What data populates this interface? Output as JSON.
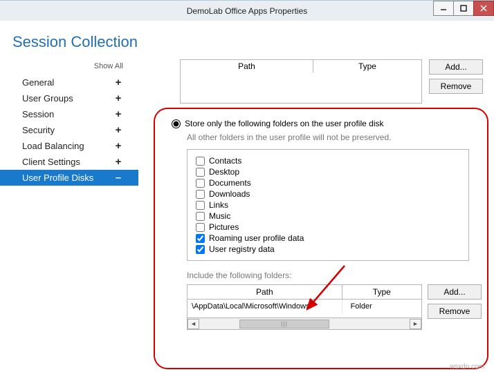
{
  "window": {
    "title": "DemoLab Office Apps Properties"
  },
  "page_title": "Session Collection",
  "show_all": "Show All",
  "nav": [
    {
      "label": "General",
      "exp": "+"
    },
    {
      "label": "User Groups",
      "exp": "+"
    },
    {
      "label": "Session",
      "exp": "+"
    },
    {
      "label": "Security",
      "exp": "+"
    },
    {
      "label": "Load Balancing",
      "exp": "+"
    },
    {
      "label": "Client Settings",
      "exp": "+"
    },
    {
      "label": "User Profile Disks",
      "exp": "–"
    }
  ],
  "top_table": {
    "col_path": "Path",
    "col_type": "Type",
    "add": "Add...",
    "remove": "Remove"
  },
  "radio_label": "Store only the following folders on the user profile disk",
  "note": "All other folders in the user profile will not be preserved.",
  "folders": [
    {
      "label": "Contacts",
      "checked": false
    },
    {
      "label": "Desktop",
      "checked": false
    },
    {
      "label": "Documents",
      "checked": false
    },
    {
      "label": "Downloads",
      "checked": false
    },
    {
      "label": "Links",
      "checked": false
    },
    {
      "label": "Music",
      "checked": false
    },
    {
      "label": "Pictures",
      "checked": false
    },
    {
      "label": "Roaming user profile data",
      "checked": true
    },
    {
      "label": "User registry data",
      "checked": true
    }
  ],
  "include_label": "Include the following folders:",
  "include_table": {
    "col_path": "Path",
    "col_type": "Type",
    "row_path": "\\AppData\\Local\\Microsoft\\Windows",
    "row_type": "Folder",
    "add": "Add...",
    "remove": "Remove"
  },
  "watermark": "wsxdn.com"
}
